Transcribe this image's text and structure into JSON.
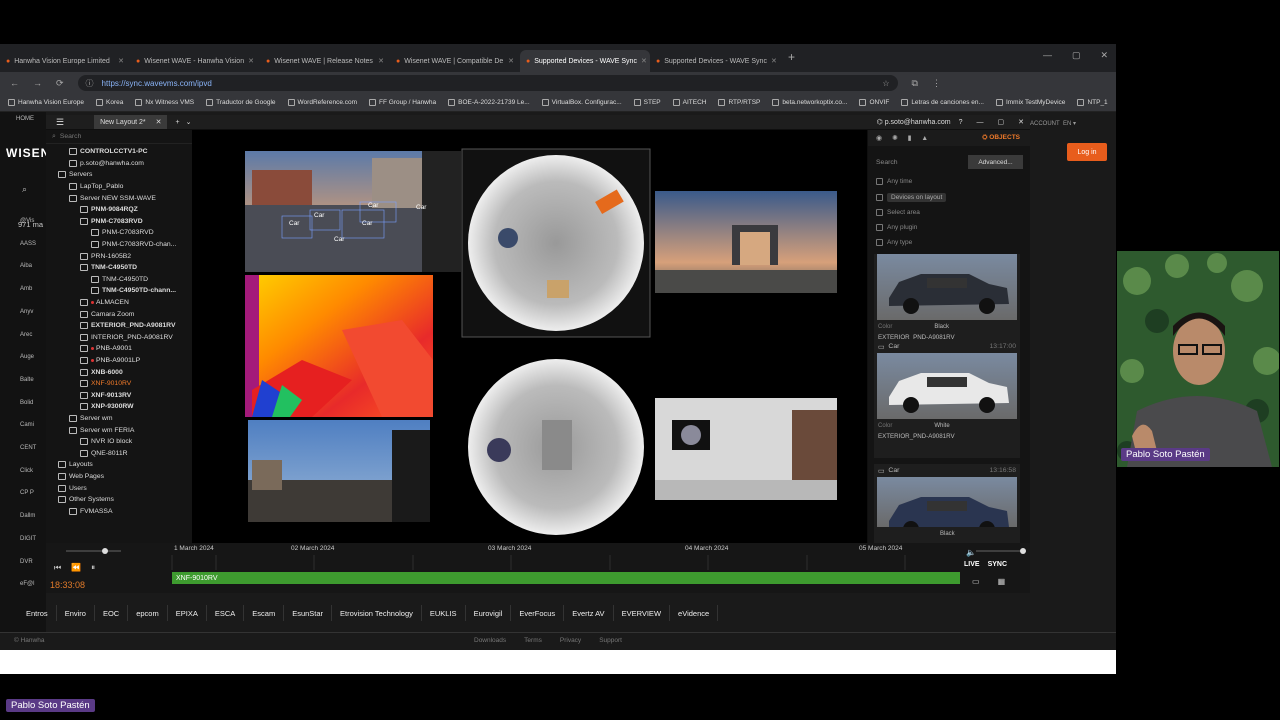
{
  "browser": {
    "tabs": [
      "Hanwha Vision Europe Limited",
      "Wisenet WAVE - Hanwha Vision",
      "Wisenet WAVE | Release Notes",
      "Wisenet WAVE | Compatible De",
      "Supported Devices - WAVE Sync",
      "Supported Devices - WAVE Sync"
    ],
    "active_tab": 4,
    "url": "https://sync.wavevms.com/ipvd",
    "bookmarks": [
      "Hanwha Vision Europe",
      "Korea",
      "Nx Witness VMS",
      "Traductor de Google",
      "WordReference.com",
      "FF Group / Hanwha",
      "BOE-A-2022-21739 Le...",
      "VirtualBox. Configurac...",
      "STEP",
      "AITECH",
      "RTP/RTSP",
      "beta.networkoptix.co...",
      "ONVIF",
      "Letras de canciones en...",
      "Immix TestMyDevice",
      "NTP_1"
    ]
  },
  "site": {
    "nav_home": "HOME",
    "brand": "WISEN",
    "count": "971 ma",
    "left_list": [
      "@Vis",
      "AASS",
      "Aiba",
      "Amb",
      "Anyv",
      "Arec",
      "Auge",
      "Balte",
      "Bolid",
      "Cami",
      "CENT",
      "Click",
      "CP P",
      "Dallm",
      "DIGIT",
      "DVR",
      "eF@l"
    ],
    "account": "ACCOUNT",
    "lang": "EN",
    "login": "Log in",
    "vendors": [
      "Entros",
      "Enviro",
      "EOC",
      "epcom",
      "EPIXA",
      "ESCA",
      "Escam",
      "EsunStar",
      "Etrovision Technology",
      "EUKLIS",
      "Eurovigil",
      "EverFocus",
      "Evertz AV",
      "EVERVIEW",
      "eVidence"
    ],
    "copyright": "© Hanwha",
    "footer_links": [
      "Downloads",
      "Terms",
      "Privacy",
      "Support"
    ]
  },
  "client": {
    "layout_tab": "New Layout 2*",
    "user": "p.soto@hanwha.com",
    "search_placeholder": "Search",
    "tree": [
      {
        "t": "CONTROLCCTV1-PC",
        "lv": 1,
        "cls": "bold"
      },
      {
        "t": "p.soto@hanwha.com",
        "lv": 1,
        "cls": ""
      },
      {
        "t": "Servers",
        "lv": 0,
        "cls": ""
      },
      {
        "t": "LapTop_Pablo",
        "lv": 1,
        "cls": ""
      },
      {
        "t": "Server NEW SSM-WAVE",
        "lv": 1,
        "cls": ""
      },
      {
        "t": "PNM-9084RQZ",
        "lv": 2,
        "cls": "bold"
      },
      {
        "t": "PNM-C7083RVD",
        "lv": 2,
        "cls": "bold"
      },
      {
        "t": "PNM-C7083RVD",
        "lv": 3,
        "cls": ""
      },
      {
        "t": "PNM-C7083RVD-chan...",
        "lv": 3,
        "cls": ""
      },
      {
        "t": "PRN-1605B2",
        "lv": 2,
        "cls": ""
      },
      {
        "t": "TNM-C4950TD",
        "lv": 2,
        "cls": "bold"
      },
      {
        "t": "TNM-C4950TD",
        "lv": 3,
        "cls": ""
      },
      {
        "t": "TNM-C4950TD-chann...",
        "lv": 3,
        "cls": "bold"
      },
      {
        "t": "ALMACEN",
        "lv": 2,
        "cls": "red"
      },
      {
        "t": "Camara Zoom",
        "lv": 2,
        "cls": ""
      },
      {
        "t": "EXTERIOR_PND-A9081RV",
        "lv": 2,
        "cls": "bold"
      },
      {
        "t": "INTERIOR_PND-A9081RV",
        "lv": 2,
        "cls": ""
      },
      {
        "t": "PNB-A9001",
        "lv": 2,
        "cls": "red"
      },
      {
        "t": "PNB-A9001LP",
        "lv": 2,
        "cls": "red"
      },
      {
        "t": "XNB-6000",
        "lv": 2,
        "cls": "bold"
      },
      {
        "t": "XNF-9010RV",
        "lv": 2,
        "cls": "orange"
      },
      {
        "t": "XNF-9013RV",
        "lv": 2,
        "cls": "bold"
      },
      {
        "t": "XNP-9300RW",
        "lv": 2,
        "cls": "bold"
      },
      {
        "t": "Server wm",
        "lv": 1,
        "cls": ""
      },
      {
        "t": "Server wm FERIA",
        "lv": 1,
        "cls": ""
      },
      {
        "t": "NVR IO block",
        "lv": 2,
        "cls": ""
      },
      {
        "t": "QNE-8011R",
        "lv": 2,
        "cls": ""
      },
      {
        "t": "Layouts",
        "lv": 0,
        "cls": ""
      },
      {
        "t": "Web Pages",
        "lv": 0,
        "cls": ""
      },
      {
        "t": "Users",
        "lv": 0,
        "cls": ""
      },
      {
        "t": "Other Systems",
        "lv": 0,
        "cls": ""
      },
      {
        "t": "FVMASSA",
        "lv": 1,
        "cls": ""
      }
    ],
    "overlay_labels": [
      "Car",
      "Car",
      "Car",
      "Car",
      "Car",
      "Car"
    ]
  },
  "objects": {
    "tab": "OBJECTS",
    "search": "Search",
    "advanced": "Advanced...",
    "filters": [
      "Any time",
      "Devices on layout",
      "Select area",
      "Any plugin",
      "Any type"
    ],
    "cards": [
      {
        "type": "",
        "time": "",
        "color_label": "Color",
        "color": "Black",
        "camera": "EXTERIOR_PND-A9081RV",
        "car_color": "#2a2e36"
      },
      {
        "type": "Car",
        "time": "13:17:00",
        "color_label": "Color",
        "color": "White",
        "camera": "EXTERIOR_PND-A9081RV",
        "car_color": "#e8e8e8"
      },
      {
        "type": "Car",
        "time": "13:16:58",
        "color_label": "Color",
        "color": "Black",
        "camera": "",
        "car_color": "#2a3550"
      }
    ]
  },
  "timeline": {
    "dates": [
      "1 March 2024",
      "02 March 2024",
      "03 March 2024",
      "04 March 2024",
      "05 March 2024"
    ],
    "time": "18:33:08",
    "camera": "XNF-9010RV",
    "live": "LIVE",
    "sync": "SYNC"
  },
  "webcam": {
    "name": "Pablo Soto Pastén"
  },
  "caption": "Pablo Soto Pastén"
}
